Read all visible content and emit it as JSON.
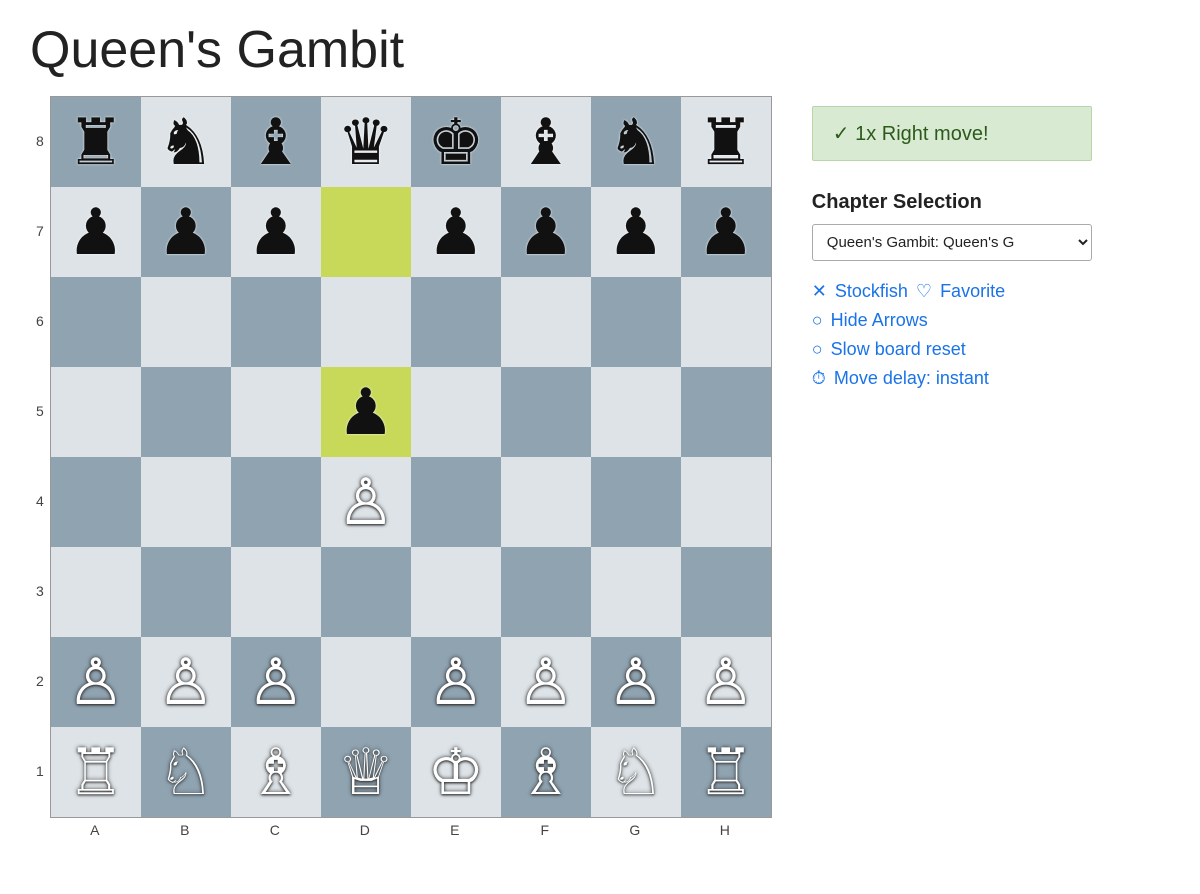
{
  "title": "Queen's Gambit",
  "board": {
    "ranks": [
      "8",
      "7",
      "6",
      "5",
      "4",
      "3",
      "2",
      "1"
    ],
    "files": [
      "A",
      "B",
      "C",
      "D",
      "E",
      "F",
      "G",
      "H"
    ],
    "cells": [
      {
        "piece": "♜",
        "color": "black",
        "bg": "dark"
      },
      {
        "piece": "♞",
        "color": "black",
        "bg": "light"
      },
      {
        "piece": "♝",
        "color": "black",
        "bg": "dark"
      },
      {
        "piece": "♛",
        "color": "black",
        "bg": "light"
      },
      {
        "piece": "♚",
        "color": "black",
        "bg": "dark"
      },
      {
        "piece": "♝",
        "color": "black",
        "bg": "light"
      },
      {
        "piece": "♞",
        "color": "black",
        "bg": "dark"
      },
      {
        "piece": "♜",
        "color": "black",
        "bg": "light"
      },
      {
        "piece": "♟",
        "color": "black",
        "bg": "light"
      },
      {
        "piece": "♟",
        "color": "black",
        "bg": "dark"
      },
      {
        "piece": "♟",
        "color": "black",
        "bg": "light"
      },
      {
        "piece": "",
        "color": "",
        "bg": "highlight"
      },
      {
        "piece": "♟",
        "color": "black",
        "bg": "light"
      },
      {
        "piece": "♟",
        "color": "black",
        "bg": "dark"
      },
      {
        "piece": "♟",
        "color": "black",
        "bg": "light"
      },
      {
        "piece": "♟",
        "color": "black",
        "bg": "dark"
      },
      {
        "piece": "",
        "color": "",
        "bg": "dark"
      },
      {
        "piece": "",
        "color": "",
        "bg": "light"
      },
      {
        "piece": "",
        "color": "",
        "bg": "dark"
      },
      {
        "piece": "",
        "color": "",
        "bg": "light"
      },
      {
        "piece": "",
        "color": "",
        "bg": "dark"
      },
      {
        "piece": "",
        "color": "",
        "bg": "light"
      },
      {
        "piece": "",
        "color": "",
        "bg": "dark"
      },
      {
        "piece": "",
        "color": "",
        "bg": "light"
      },
      {
        "piece": "",
        "color": "",
        "bg": "light"
      },
      {
        "piece": "",
        "color": "",
        "bg": "dark"
      },
      {
        "piece": "",
        "color": "",
        "bg": "light"
      },
      {
        "piece": "♟",
        "color": "black",
        "bg": "highlight"
      },
      {
        "piece": "",
        "color": "",
        "bg": "light"
      },
      {
        "piece": "",
        "color": "",
        "bg": "dark"
      },
      {
        "piece": "",
        "color": "",
        "bg": "light"
      },
      {
        "piece": "",
        "color": "",
        "bg": "dark"
      },
      {
        "piece": "",
        "color": "",
        "bg": "dark"
      },
      {
        "piece": "",
        "color": "",
        "bg": "light"
      },
      {
        "piece": "",
        "color": "",
        "bg": "dark"
      },
      {
        "piece": "♙",
        "color": "white",
        "bg": "light"
      },
      {
        "piece": "",
        "color": "",
        "bg": "dark"
      },
      {
        "piece": "",
        "color": "",
        "bg": "light"
      },
      {
        "piece": "",
        "color": "",
        "bg": "dark"
      },
      {
        "piece": "",
        "color": "",
        "bg": "light"
      },
      {
        "piece": "",
        "color": "",
        "bg": "light"
      },
      {
        "piece": "",
        "color": "",
        "bg": "dark"
      },
      {
        "piece": "",
        "color": "",
        "bg": "light"
      },
      {
        "piece": "",
        "color": "",
        "bg": "dark"
      },
      {
        "piece": "",
        "color": "",
        "bg": "light"
      },
      {
        "piece": "",
        "color": "",
        "bg": "dark"
      },
      {
        "piece": "",
        "color": "",
        "bg": "light"
      },
      {
        "piece": "",
        "color": "",
        "bg": "dark"
      },
      {
        "piece": "♙",
        "color": "white",
        "bg": "dark"
      },
      {
        "piece": "♙",
        "color": "white",
        "bg": "light"
      },
      {
        "piece": "♙",
        "color": "white",
        "bg": "dark"
      },
      {
        "piece": "",
        "color": "",
        "bg": "light"
      },
      {
        "piece": "♙",
        "color": "white",
        "bg": "dark"
      },
      {
        "piece": "♙",
        "color": "white",
        "bg": "light"
      },
      {
        "piece": "♙",
        "color": "white",
        "bg": "dark"
      },
      {
        "piece": "♙",
        "color": "white",
        "bg": "light"
      },
      {
        "piece": "♖",
        "color": "white",
        "bg": "light"
      },
      {
        "piece": "♘",
        "color": "white",
        "bg": "dark"
      },
      {
        "piece": "♗",
        "color": "white",
        "bg": "light"
      },
      {
        "piece": "♕",
        "color": "white",
        "bg": "dark"
      },
      {
        "piece": "♔",
        "color": "white",
        "bg": "light"
      },
      {
        "piece": "♗",
        "color": "white",
        "bg": "dark"
      },
      {
        "piece": "♘",
        "color": "white",
        "bg": "light"
      },
      {
        "piece": "♖",
        "color": "white",
        "bg": "dark"
      }
    ]
  },
  "right_panel": {
    "success_message": "✓ 1x Right move!",
    "chapter_selection": {
      "title": "Chapter Selection",
      "select_value": "Queen's Gambit: Queen's G",
      "select_placeholder": "Queen&#39;s Gambit: Queen&#39;s G"
    },
    "options": [
      {
        "icon": "✕",
        "icon_name": "stockfish-icon",
        "label": "Stockfish",
        "separator": true,
        "icon2": "♡",
        "icon2_name": "favorite-icon",
        "label2": "Favorite"
      },
      {
        "icon": "○",
        "icon_name": "hide-arrows-icon",
        "label": "Hide Arrows"
      },
      {
        "icon": "○",
        "icon_name": "slow-board-reset-icon",
        "label": "Slow board reset"
      },
      {
        "icon": "⏱",
        "icon_name": "move-delay-icon",
        "label": "Move delay: instant"
      }
    ]
  }
}
